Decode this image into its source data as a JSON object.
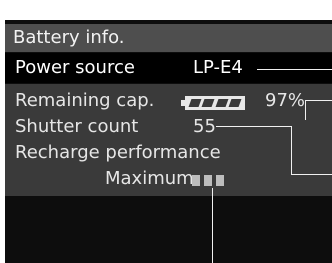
{
  "title": "Battery info.",
  "power_source": {
    "label": "Power source",
    "value": "LP-E4"
  },
  "remaining_capacity": {
    "label": "Remaining cap.",
    "percent_text": "97%",
    "percent": 97,
    "battery_icon": "battery-level-icon"
  },
  "shutter_count": {
    "label": "Shutter count",
    "value": "55"
  },
  "recharge_performance": {
    "label": "Recharge performance",
    "level_text": "Maximum",
    "level_boxes": 3
  },
  "colors": {
    "title_bar": "#4e4e4e",
    "panel": "#3a3a3a",
    "background": "#0d0d0d",
    "text": "#f2f2f2"
  }
}
